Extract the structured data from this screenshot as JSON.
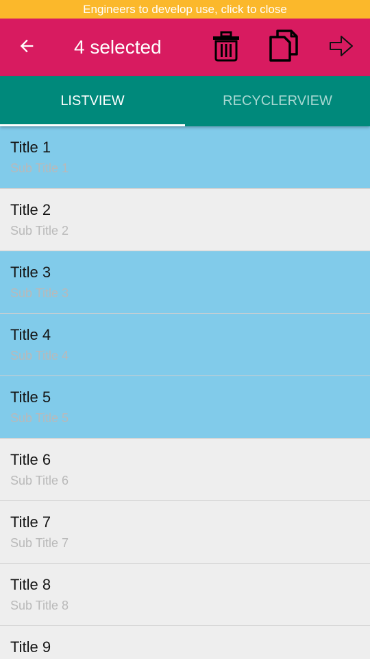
{
  "banner": {
    "text": "Engineers to develop use, click to close"
  },
  "actionbar": {
    "title": "4 selected",
    "icons": [
      "arrow-back-icon",
      "trash-icon",
      "copy-icon",
      "share-arrow-icon"
    ]
  },
  "colors": {
    "banner": "#FBB82B",
    "actionbar": "#D81B60",
    "tabs": "#00897B",
    "selected_row": "#81CBEA",
    "row": "#EEEEEE"
  },
  "tabs": [
    {
      "label": "LISTVIEW",
      "active": true
    },
    {
      "label": "RECYCLERVIEW",
      "active": false
    }
  ],
  "list": [
    {
      "title": "Title 1",
      "subtitle": "Sub Title 1",
      "selected": true
    },
    {
      "title": "Title 2",
      "subtitle": "Sub Title 2",
      "selected": false
    },
    {
      "title": "Title 3",
      "subtitle": "Sub Title 3",
      "selected": true
    },
    {
      "title": "Title 4",
      "subtitle": "Sub Title 4",
      "selected": true
    },
    {
      "title": "Title 5",
      "subtitle": "Sub Title 5",
      "selected": true
    },
    {
      "title": "Title 6",
      "subtitle": "Sub Title 6",
      "selected": false
    },
    {
      "title": "Title 7",
      "subtitle": "Sub Title 7",
      "selected": false
    },
    {
      "title": "Title 8",
      "subtitle": "Sub Title 8",
      "selected": false
    },
    {
      "title": "Title 9",
      "subtitle": "",
      "selected": false
    }
  ]
}
